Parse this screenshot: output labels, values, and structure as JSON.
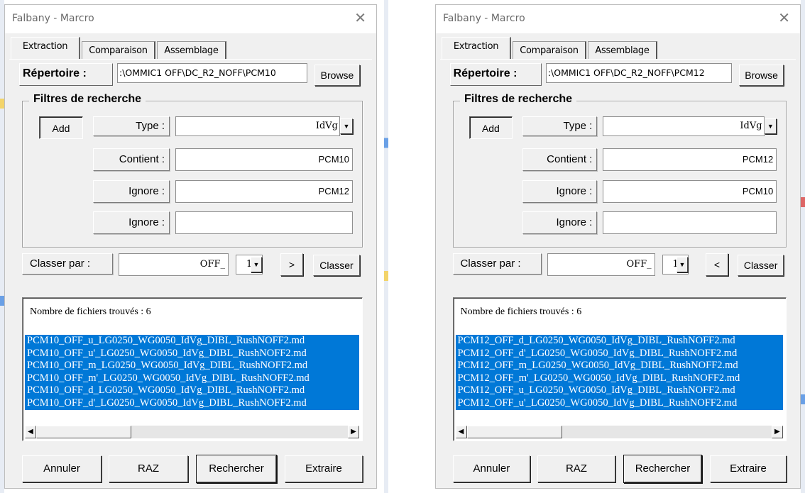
{
  "colors": {
    "selection": "#0078d7",
    "dialog_bg": "#f0f0f0",
    "title_text": "#6a6a6a"
  },
  "icons": {
    "close": "close-icon",
    "dropdown": "chevron-down-icon",
    "scroll_left": "arrow-left-icon",
    "scroll_right": "arrow-right-icon"
  },
  "dialogs": [
    {
      "title": "Falbany - Marcro",
      "close_glyph": "✕",
      "tabs": [
        "Extraction",
        "Comparaison",
        "Assemblage"
      ],
      "repertoire_label": "Répertoire :",
      "repertoire_value": ":\\OMMIC1 OFF\\DC_R2_NOFF\\PCM10",
      "browse_label": "Browse",
      "filters_title": "Filtres de recherche",
      "add_label": "Add",
      "filters": [
        {
          "label": "Type :",
          "value": "IdVg",
          "dropdown": true
        },
        {
          "label": "Contient :",
          "value": "PCM10"
        },
        {
          "label": "Ignore :",
          "value": "PCM12"
        },
        {
          "label": "Ignore :",
          "value": ""
        }
      ],
      "sort_label": "Classer par :",
      "sort_value": "OFF_",
      "sort_index": "1",
      "order_label": ">",
      "classer_label": "Classer",
      "count_text": "Nombre de fichiers trouvés : 6",
      "files": [
        "PCM10_OFF_u_LG0250_WG0050_IdVg_DIBL_RushNOFF2.md",
        "PCM10_OFF_u'_LG0250_WG0050_IdVg_DIBL_RushNOFF2.md",
        "PCM10_OFF_m_LG0250_WG0050_IdVg_DIBL_RushNOFF2.md",
        "PCM10_OFF_m'_LG0250_WG0050_IdVg_DIBL_RushNOFF2.md",
        "PCM10_OFF_d_LG0250_WG0050_IdVg_DIBL_RushNOFF2.md",
        "PCM10_OFF_d'_LG0250_WG0050_IdVg_DIBL_RushNOFF2.md"
      ],
      "buttons": [
        "Annuler",
        "RAZ",
        "Rechercher",
        "Extraire"
      ]
    },
    {
      "title": "Falbany - Marcro",
      "close_glyph": "✕",
      "tabs": [
        "Extraction",
        "Comparaison",
        "Assemblage"
      ],
      "repertoire_label": "Répertoire :",
      "repertoire_value": ":\\OMMIC1 OFF\\DC_R2_NOFF\\PCM12",
      "browse_label": "Browse",
      "filters_title": "Filtres de recherche",
      "add_label": "Add",
      "filters": [
        {
          "label": "Type :",
          "value": "IdVg",
          "dropdown": true
        },
        {
          "label": "Contient :",
          "value": "PCM12"
        },
        {
          "label": "Ignore :",
          "value": "PCM10"
        },
        {
          "label": "Ignore :",
          "value": ""
        }
      ],
      "sort_label": "Classer par :",
      "sort_value": "OFF_",
      "sort_index": "1",
      "order_label": "<",
      "classer_label": "Classer",
      "count_text": "Nombre de fichiers trouvés : 6",
      "files": [
        "PCM12_OFF_d_LG0250_WG0050_IdVg_DIBL_RushNOFF2.md",
        "PCM12_OFF_d'_LG0250_WG0050_IdVg_DIBL_RushNOFF2.md",
        "PCM12_OFF_m_LG0250_WG0050_IdVg_DIBL_RushNOFF2.md",
        "PCM12_OFF_m'_LG0250_WG0050_IdVg_DIBL_RushNOFF2.md",
        "PCM12_OFF_u_LG0250_WG0050_IdVg_DIBL_RushNOFF2.md",
        "PCM12_OFF_u'_LG0250_WG0050_IdVg_DIBL_RushNOFF2.md"
      ],
      "buttons": [
        "Annuler",
        "RAZ",
        "Rechercher",
        "Extraire"
      ]
    }
  ]
}
